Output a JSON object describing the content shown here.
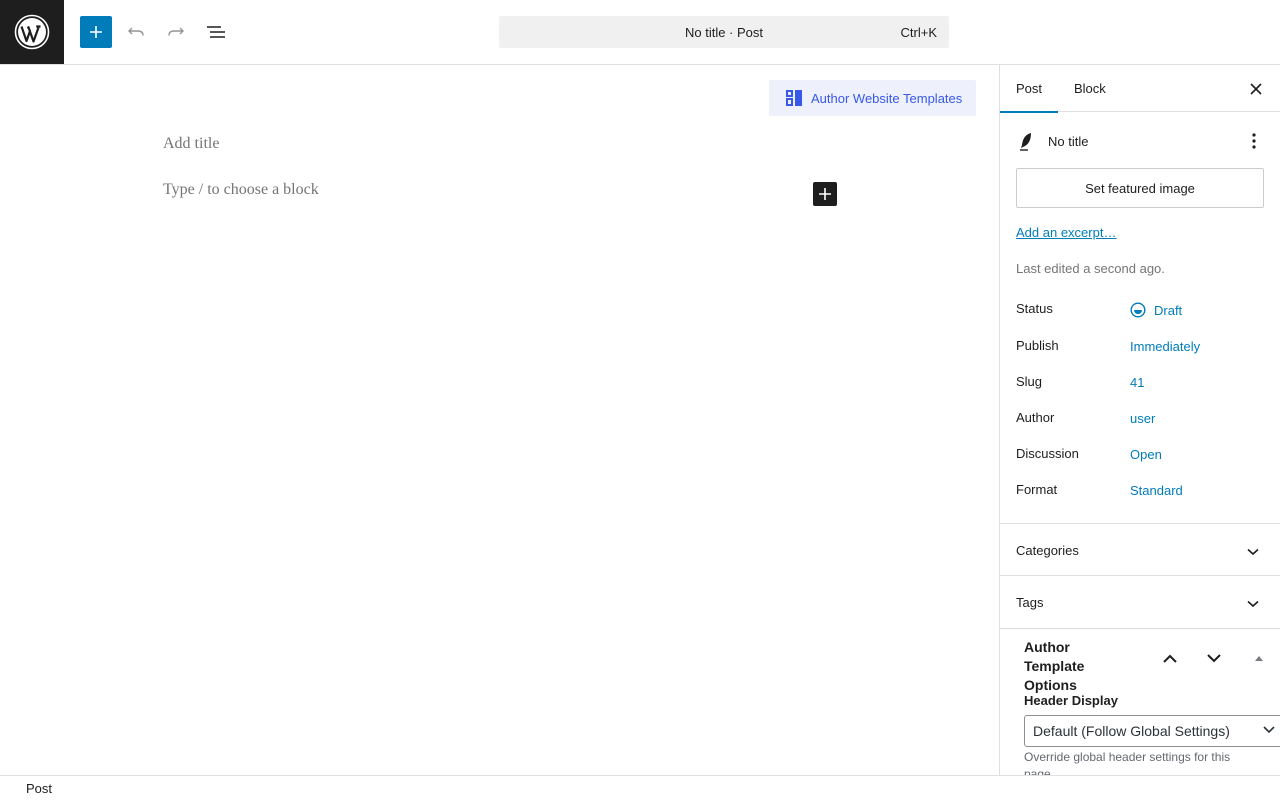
{
  "topbar": {
    "logo_icon": "wordpress-logo-icon",
    "add_icon": "plus-icon",
    "undo_icon": "undo-icon",
    "redo_icon": "redo-icon",
    "list_view_icon": "list-view-icon",
    "command_bar": {
      "title": "No title · Post",
      "shortcut": "Ctrl+K"
    }
  },
  "editor": {
    "templates_button": "Author Website Templates",
    "title_placeholder": "Add title",
    "block_placeholder": "Type / to choose a block"
  },
  "sidebar": {
    "tabs": [
      {
        "label": "Post"
      },
      {
        "label": "Block"
      }
    ],
    "active_tab": "Post",
    "post_title": "No title",
    "featured_image_button": "Set featured image",
    "excerpt_link": "Add an excerpt…",
    "last_edited": "Last edited a second ago.",
    "meta": [
      {
        "label": "Status",
        "value": "Draft"
      },
      {
        "label": "Publish",
        "value": "Immediately"
      },
      {
        "label": "Slug",
        "value": "41"
      },
      {
        "label": "Author",
        "value": "user"
      },
      {
        "label": "Discussion",
        "value": "Open"
      },
      {
        "label": "Format",
        "value": "Standard"
      }
    ],
    "panels": [
      {
        "title": "Categories"
      },
      {
        "title": "Tags"
      }
    ],
    "meta_box": {
      "title": "Author Template Options",
      "header_display_label": "Header Display",
      "header_display_value": "Default (Follow Global Settings)",
      "help_text": "Override global header settings for this page."
    }
  },
  "footer": {
    "breadcrumb": "Post"
  },
  "colors": {
    "accent": "#007cba",
    "dark": "#1e1e1e",
    "template_accent": "#3858e9"
  }
}
